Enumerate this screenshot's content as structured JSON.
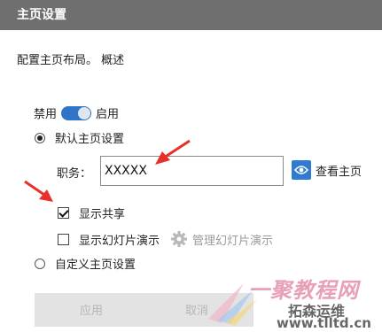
{
  "window": {
    "title": "主页设置"
  },
  "description": "配置主页布局。 概述",
  "toggle": {
    "off_label": "禁用",
    "on_label": "启用",
    "state": "on"
  },
  "default_home": {
    "label": "默认主页设置",
    "selected": true
  },
  "position_field": {
    "label": "职务：",
    "value": "XXXXX"
  },
  "view_home_button": {
    "label": "查看主页",
    "icon": "eye-icon"
  },
  "show_sharing": {
    "label": "显示共享",
    "checked": true
  },
  "show_slideshow": {
    "label": "显示幻灯片演示",
    "checked": false
  },
  "manage_slideshow": {
    "label": "管理幻灯片演示",
    "icon": "gear-icon",
    "enabled": false
  },
  "custom_home": {
    "label": "自定义主页设置",
    "selected": false
  },
  "buttons": {
    "apply": "应用",
    "cancel": "取消"
  },
  "watermark": {
    "brand": "一聚教程网",
    "sub": "拓森运维",
    "url": "www.tlltd.cn"
  },
  "colors": {
    "titlebar": "#6f6f6f",
    "accent": "#2e7bcf",
    "annotation_arrow": "#e8302a"
  }
}
